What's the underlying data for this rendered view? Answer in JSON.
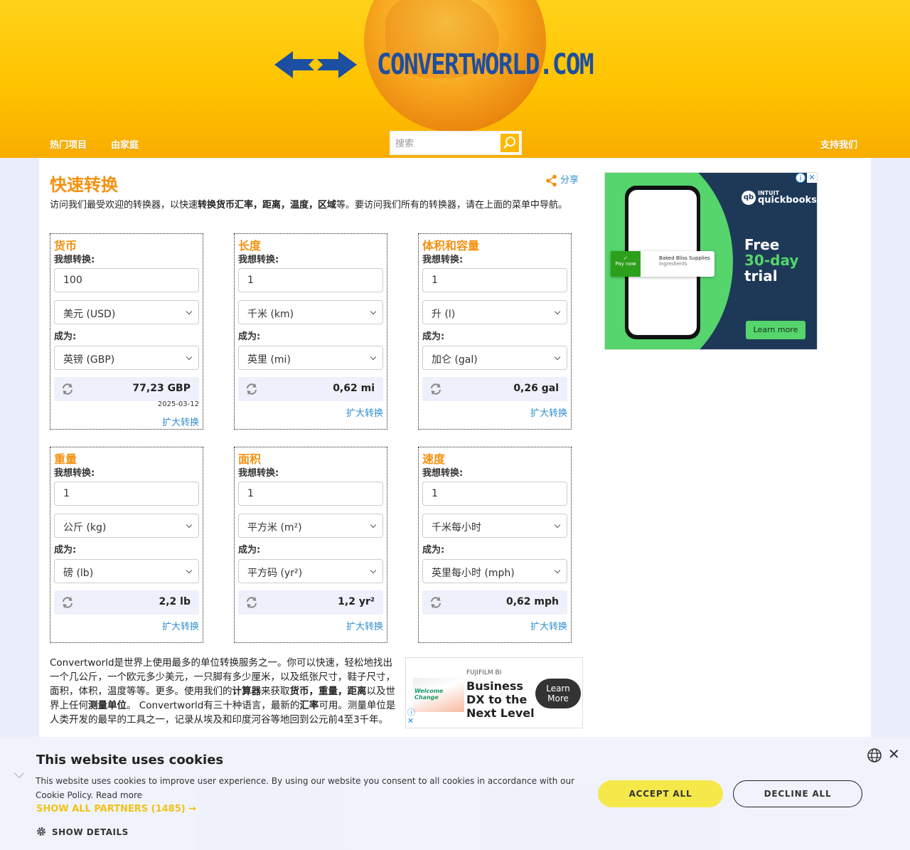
{
  "header": {
    "logo_text": "CONVERTWORLD.COM",
    "nav": {
      "popular": "热门项目",
      "family": "由家庭",
      "support": "支持我们"
    },
    "search": {
      "placeholder": "搜索"
    }
  },
  "page": {
    "title": "快速转换",
    "share": "分享",
    "intro_parts": [
      "访问我们最受欢迎的转换器，以快速",
      "转换货币汇率，距离，温度，区域",
      "等。要访问我们所有的转换器，请在上面的菜单中导航。"
    ]
  },
  "converters": [
    {
      "title": "货币",
      "from_label": "我想转换:",
      "amount": "100",
      "from_unit": "美元 (USD)",
      "to_label": "成为:",
      "to_unit": "英镑 (GBP)",
      "result": "77,23 GBP",
      "date": "2025-03-12",
      "expand": "扩大转换"
    },
    {
      "title": "长度",
      "from_label": "我想转换:",
      "amount": "1",
      "from_unit": "千米 (km)",
      "to_label": "成为:",
      "to_unit": "英里 (mi)",
      "result": "0,62 mi",
      "expand": "扩大转换"
    },
    {
      "title": "体积和容量",
      "from_label": "我想转换:",
      "amount": "1",
      "from_unit": "升 (l)",
      "to_label": "成为:",
      "to_unit": "加仑 (gal)",
      "result": "0,26 gal",
      "expand": "扩大转换"
    },
    {
      "title": "重量",
      "from_label": "我想转换:",
      "amount": "1",
      "from_unit": "公斤 (kg)",
      "to_label": "成为:",
      "to_unit": "磅 (lb)",
      "result": "2,2 lb",
      "expand": "扩大转换"
    },
    {
      "title": "面积",
      "from_label": "我想转换:",
      "amount": "1",
      "from_unit": "平方米 (m²)",
      "to_label": "成为:",
      "to_unit": "平方码 (yr²)",
      "result": "1,2 yr²",
      "expand": "扩大转换"
    },
    {
      "title": "速度",
      "from_label": "我想转换:",
      "amount": "1",
      "from_unit": "千米每小时",
      "to_label": "成为:",
      "to_unit": "英里每小时 (mph)",
      "result": "0,62 mph",
      "expand": "扩大转换"
    }
  ],
  "about": {
    "p1": "Convertworld是世界上使用最多的单位转换服务之一。你可以快速，轻松地找出一个几公斤，一个欧元多少美元，一只脚有多少厘米，以及纸张尺寸，鞋子尺寸，面积，体积，温度等等。更多。使用我们的",
    "b1": "计算器",
    "p2": "来获取",
    "b2": "货币，重量，距离",
    "p3": "以及世界上任何",
    "b3": "测量单位",
    "p4": "。 Convertworld有三十种语言，最新的",
    "b4": "汇率",
    "p5": "可用。测量单位是人类开发的最早的工具之一，记录从埃及和印度河谷等地回到公元前4至3千年。"
  },
  "ads": {
    "quickbooks": {
      "brand": "quickbooks",
      "brand_top": "INTUIT",
      "line1": "Free",
      "line2": "30-day",
      "line3": "trial",
      "cta": "Learn more",
      "pill_title": "Baked Bliss Supplies",
      "pill_sub": "Ingredients",
      "pay": "Pay now"
    },
    "fujifilm": {
      "brand": "FUJIFILM BI",
      "headline": "Business DX to the Next Level",
      "cta": "Learn More",
      "img_text": "Welcome Change"
    }
  },
  "cookie": {
    "title": "This website uses cookies",
    "description": "This website uses cookies to improve user experience. By using our website you consent to all cookies in accordance with our Cookie Policy.",
    "read_more": "Read more",
    "partners": "SHOW ALL PARTNERS (1485) →",
    "details": "SHOW DETAILS",
    "accept": "ACCEPT ALL",
    "decline": "DECLINE ALL"
  },
  "colors": {
    "accent": "#f29111",
    "link": "#2f8fd0",
    "header": "#ffc300",
    "logo": "#1d4fa0"
  }
}
